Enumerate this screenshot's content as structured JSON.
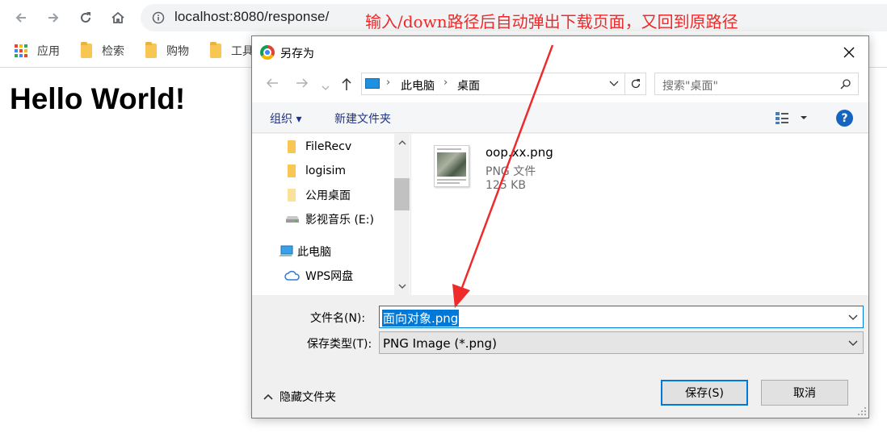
{
  "browser": {
    "url": "localhost:8080/response/",
    "annotation": "输入/down路径后自动弹出下载页面，又回到原路径",
    "bookmarks": [
      "应用",
      "检索",
      "购物",
      "工具"
    ]
  },
  "page": {
    "title": "Hello World!"
  },
  "dialog": {
    "title": "另存为",
    "breadcrumb": [
      "此电脑",
      "桌面"
    ],
    "search_placeholder": "搜索\"桌面\"",
    "organize_label": "组织 ▾",
    "new_folder_label": "新建文件夹",
    "nav_items": [
      {
        "label": "FileRecv",
        "icon": "folder-icon"
      },
      {
        "label": "logisim",
        "icon": "folder-icon"
      },
      {
        "label": "公用桌面",
        "icon": "folder-icon"
      },
      {
        "label": "影视音乐 (E:)",
        "icon": "drive-icon"
      },
      {
        "label": "此电脑",
        "icon": "computer-icon"
      },
      {
        "label": "WPS网盘",
        "icon": "cloud-icon"
      }
    ],
    "file": {
      "name": "oop.xx.png",
      "type": "PNG 文件",
      "size": "125 KB"
    },
    "filename_label": "文件名(N):",
    "filename_value": "面向对象.png",
    "filetype_label": "保存类型(T):",
    "filetype_value": "PNG Image (*.png)",
    "hide_folders_label": "隐藏文件夹",
    "save_label": "保存(S)",
    "cancel_label": "取消"
  },
  "colors": {
    "annotation": "#ee2a2a",
    "selection": "#0078d7",
    "help": "#1565c0"
  }
}
